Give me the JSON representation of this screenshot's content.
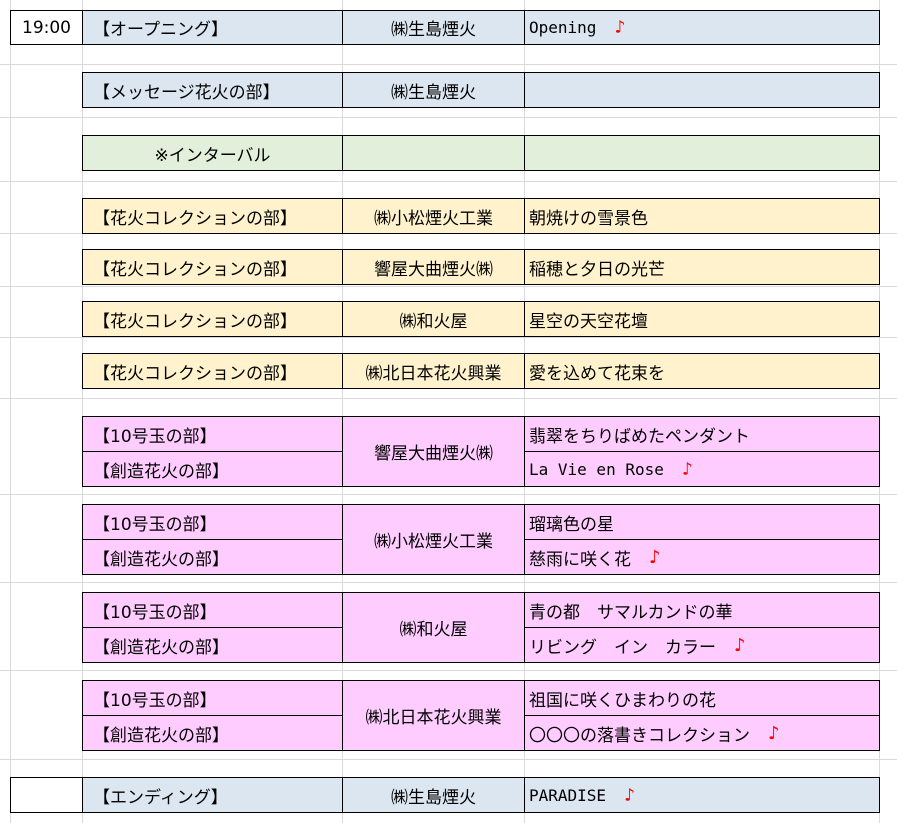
{
  "time": "19:00",
  "music_note_icon": "music-note-icon",
  "colors": {
    "blue": "#dce6f1",
    "green": "#e2efda",
    "yellow": "#fff2cc",
    "pink": "#ffccff",
    "note": "#ff0000"
  },
  "rows": [
    {
      "section": "【オープニング】",
      "company": "㈱生島煙火",
      "title": "Opening"
    },
    {
      "section": "【メッセージ花火の部】",
      "company": "㈱生島煙火",
      "title": ""
    },
    {
      "section": "※インターバル",
      "company": "",
      "title": ""
    },
    {
      "section": "【花火コレクションの部】",
      "company": "㈱小松煙火工業",
      "title": "朝焼けの雪景色"
    },
    {
      "section": "【花火コレクションの部】",
      "company": "響屋大曲煙火㈱",
      "title": "稲穂と夕日の光芒"
    },
    {
      "section": "【花火コレクションの部】",
      "company": "㈱和火屋",
      "title": "星空の天空花壇"
    },
    {
      "section": "【花火コレクションの部】",
      "company": "㈱北日本花火興業",
      "title": "愛を込めて花束を"
    }
  ],
  "groups": [
    {
      "section_a": "【10号玉の部】",
      "section_b": "【創造花火の部】",
      "company": "響屋大曲煙火㈱",
      "title_a": "翡翠をちりばめたペンダント",
      "title_b": "La Vie en Rose"
    },
    {
      "section_a": "【10号玉の部】",
      "section_b": "【創造花火の部】",
      "company": "㈱小松煙火工業",
      "title_a": "瑠璃色の星",
      "title_b": "慈雨に咲く花"
    },
    {
      "section_a": "【10号玉の部】",
      "section_b": "【創造花火の部】",
      "company": "㈱和火屋",
      "title_a": "青の都　サマルカンドの華",
      "title_b": "リビング　イン　カラー"
    },
    {
      "section_a": "【10号玉の部】",
      "section_b": "【創造花火の部】",
      "company": "㈱北日本花火興業",
      "title_a": "祖国に咲くひまわりの花",
      "title_b": "〇〇〇の落書きコレクション"
    }
  ],
  "ending": {
    "section": "【エンディング】",
    "company": "㈱生島煙火",
    "title": "PARADISE"
  },
  "note_glyph": "♪"
}
